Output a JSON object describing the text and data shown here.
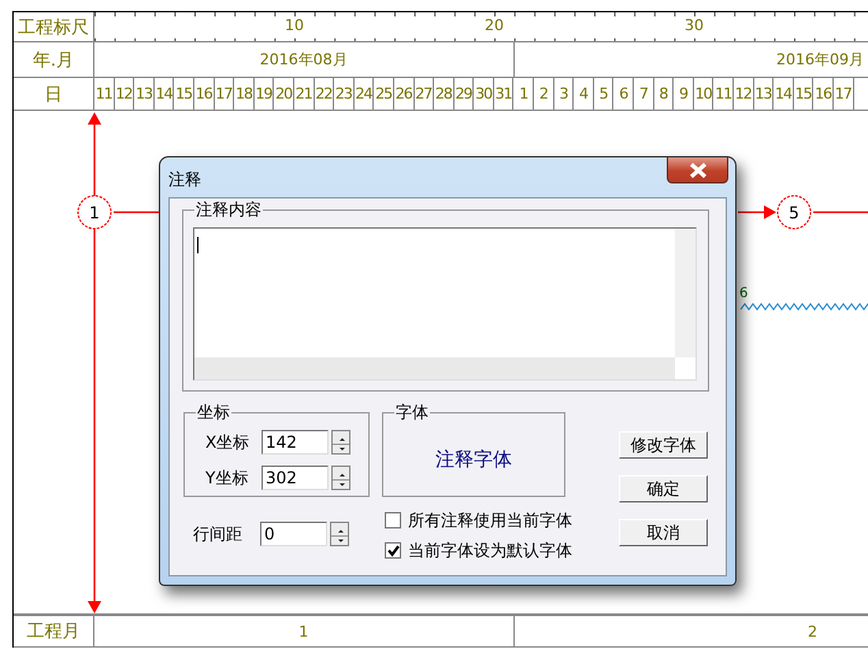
{
  "ruler": {
    "label": "工程标尺",
    "marks": [
      "10",
      "20",
      "30"
    ]
  },
  "month_row": {
    "label": "年.月"
  },
  "day_row": {
    "label": "日"
  },
  "months": [
    {
      "label": "2016年08月",
      "days": [
        "11",
        "12",
        "13",
        "14",
        "15",
        "16",
        "17",
        "18",
        "19",
        "20",
        "21",
        "22",
        "23",
        "24",
        "25",
        "26",
        "27",
        "28",
        "29",
        "30",
        "31"
      ]
    },
    {
      "label": "2016年09月",
      "days": [
        "1",
        "2",
        "3",
        "4",
        "5",
        "6",
        "7",
        "8",
        "9",
        "10",
        "11",
        "12",
        "13",
        "14",
        "15",
        "16",
        "17"
      ]
    }
  ],
  "nodes": [
    {
      "label": "1"
    },
    {
      "label": "5"
    }
  ],
  "activity_labels": [
    "6"
  ],
  "project_month_row": {
    "label": "工程月",
    "months": [
      "1",
      "2"
    ]
  },
  "dialog": {
    "title": "注释",
    "content_group": {
      "label": "注释内容"
    },
    "coords_group": {
      "label": "坐标",
      "fields": [
        {
          "label": "X坐标",
          "value": "142"
        },
        {
          "label": "Y坐标",
          "value": "302"
        }
      ]
    },
    "font_group": {
      "label": "字体",
      "sample": "注释字体"
    },
    "line_spacing": {
      "label": "行间距",
      "value": "0"
    },
    "checkboxes": [
      {
        "label": "所有注释使用当前字体",
        "checked": false
      },
      {
        "label": "当前字体设为默认字体",
        "checked": true
      }
    ],
    "buttons": [
      "修改字体",
      "确定",
      "取消"
    ]
  }
}
